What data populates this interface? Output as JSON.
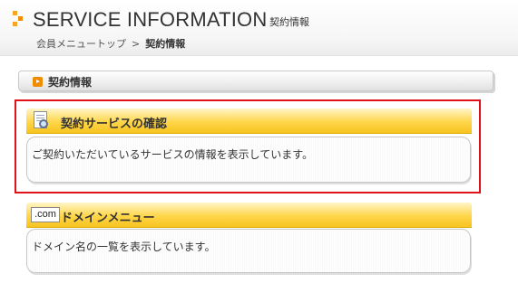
{
  "header": {
    "title": "SERVICE INFORMATION",
    "subtitle": "契約情報",
    "breadcrumb": {
      "parent": "会員メニュートップ",
      "separator": ">",
      "current": "契約情報"
    }
  },
  "section": {
    "label": "契約情報"
  },
  "cards": [
    {
      "icon": "document-search-icon",
      "title": "契約サービスの確認",
      "description": "ご契約いただいているサービスの情報を表示しています。",
      "highlighted": true
    },
    {
      "icon": "com-domain-icon",
      "icon_text": ".com",
      "title": "ドメインメニュー",
      "description": "ドメイン名の一覧を表示しています。",
      "highlighted": false
    }
  ],
  "colors": {
    "accent_orange": "#f08c00",
    "card_header_yellow": "#ffd64a",
    "highlight_red": "#e0111b"
  }
}
